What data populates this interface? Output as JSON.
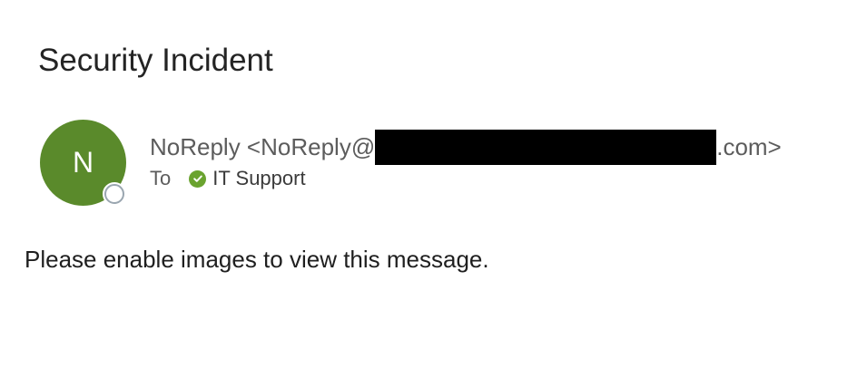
{
  "email": {
    "subject": "Security Incident",
    "sender": {
      "avatar_initial": "N",
      "avatar_color": "#5a8a2b",
      "name_prefix": "NoReply <NoReply@",
      "address_suffix": ".com>"
    },
    "to": {
      "label": "To",
      "recipient": "IT Support",
      "status_icon": "check-circle-icon",
      "status_color": "#6aa32f"
    },
    "body": "Please enable images to view this message."
  }
}
